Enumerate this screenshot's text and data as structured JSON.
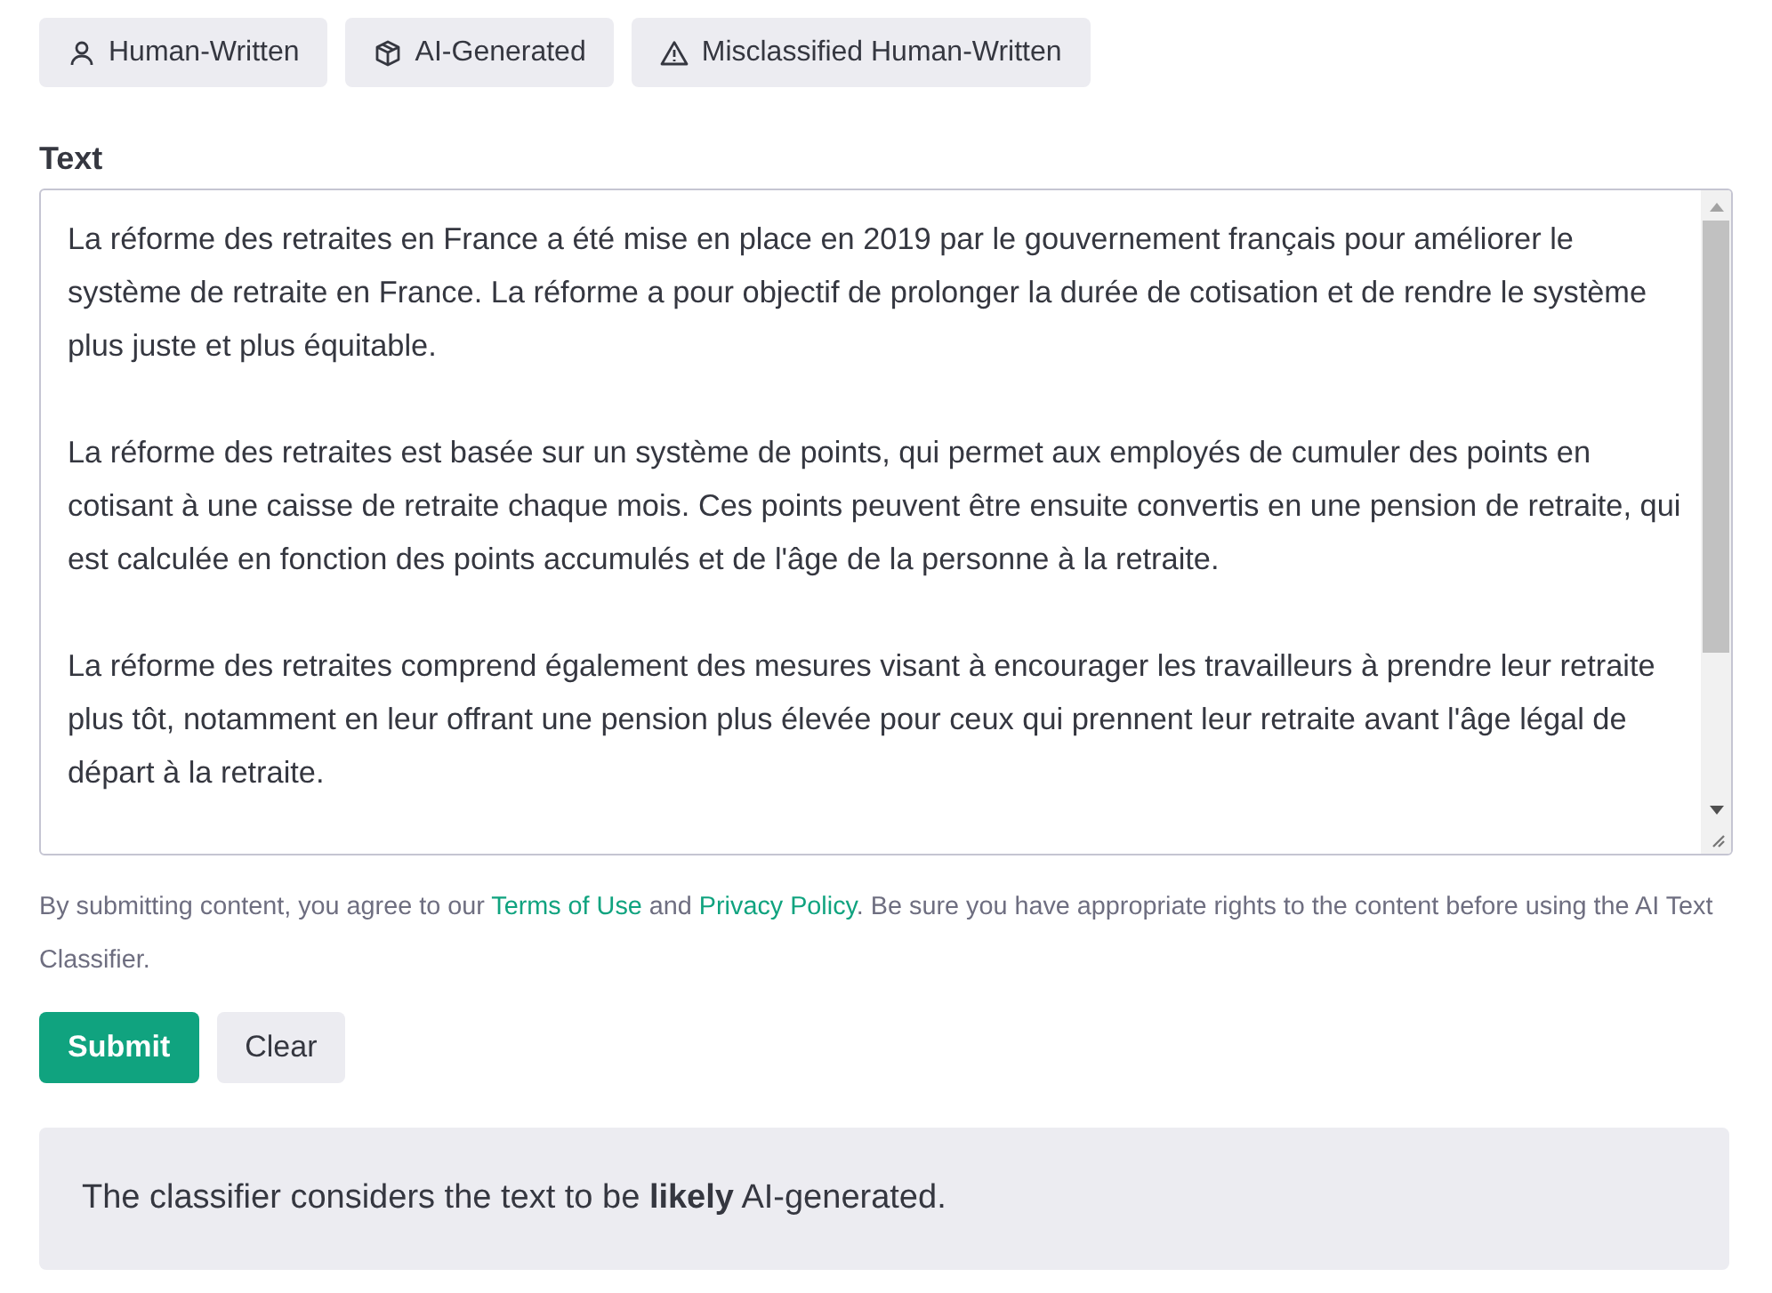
{
  "tabs": [
    {
      "label": "Human-Written",
      "kind": "person"
    },
    {
      "label": "AI-Generated",
      "kind": "cube"
    },
    {
      "label": "Misclassified Human-Written",
      "kind": "warning"
    }
  ],
  "text_field": {
    "label": "Text",
    "paragraphs": [
      "La réforme des retraites en France a été mise en place en 2019 par le gouvernement français pour améliorer le système de retraite en France. La réforme a pour objectif de prolonger la durée de cotisation et de rendre le système plus juste et plus équitable.",
      "La réforme des retraites est basée sur un système de points, qui permet aux employés de cumuler des points en cotisant à une caisse de retraite chaque mois. Ces points peuvent être ensuite convertis en une pension de retraite, qui est calculée en fonction des points accumulés et de l'âge de la personne à la retraite.",
      "La réforme des retraites comprend également des mesures visant à encourager les travailleurs à prendre leur retraite plus tôt, notamment en leur offrant une pension plus élevée pour ceux qui prennent leur retraite avant l'âge légal de départ à la retraite."
    ]
  },
  "disclaimer": {
    "before": "By submitting content, you agree to our",
    "link_1": "Terms of Use",
    "middle": "and",
    "link_2": "Privacy Policy",
    "after": ". Be sure you have appropriate rights to the content before using the AI Text Classifier."
  },
  "buttons": [
    {
      "label": "Submit",
      "kind": "primary"
    },
    {
      "label": "Clear",
      "kind": "secondary"
    }
  ],
  "result": "The classifier considers the text to be **likely** AI-generated."
}
